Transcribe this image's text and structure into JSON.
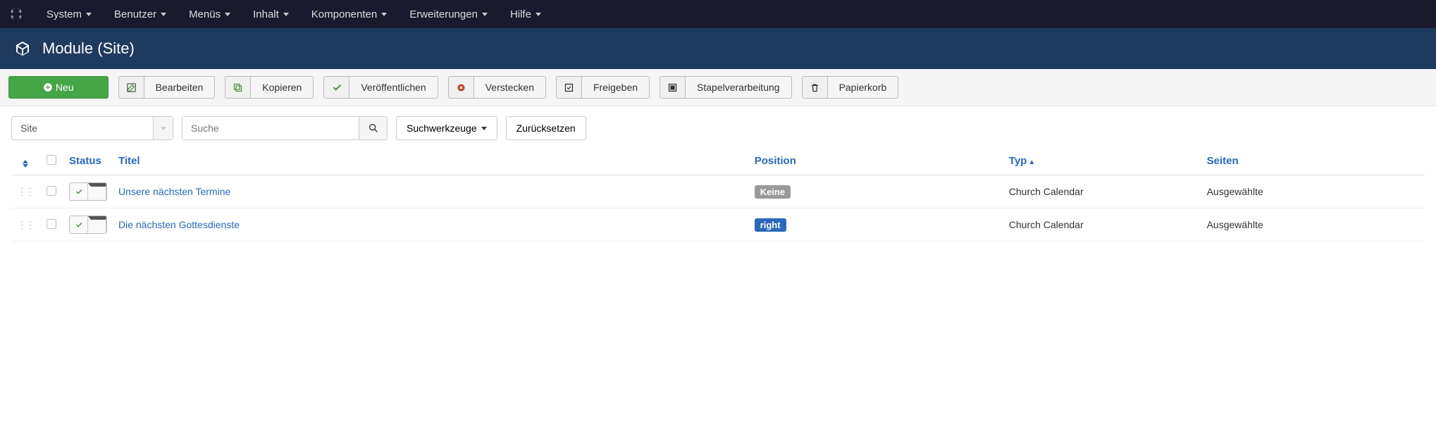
{
  "topnav": {
    "items": [
      "System",
      "Benutzer",
      "Menüs",
      "Inhalt",
      "Komponenten",
      "Erweiterungen",
      "Hilfe"
    ]
  },
  "header": {
    "title": "Module (Site)"
  },
  "toolbar": {
    "new_label": "Neu",
    "edit_label": "Bearbeiten",
    "copy_label": "Kopieren",
    "publish_label": "Veröffentlichen",
    "hide_label": "Verstecken",
    "checkin_label": "Freigeben",
    "batch_label": "Stapelverarbeitung",
    "trash_label": "Papierkorb"
  },
  "filters": {
    "client_selected": "Site",
    "search_placeholder": "Suche",
    "tools_label": "Suchwerkzeuge",
    "clear_label": "Zurücksetzen"
  },
  "columns": {
    "status": "Status",
    "title": "Titel",
    "position": "Position",
    "type": "Typ",
    "pages": "Seiten"
  },
  "rows": [
    {
      "title": "Unsere nächsten Termine",
      "position": "Keine",
      "position_style": "gray",
      "type": "Church Calendar",
      "pages": "Ausgewählte"
    },
    {
      "title": "Die nächsten Gottesdienste",
      "position": "right",
      "position_style": "blue",
      "type": "Church Calendar",
      "pages": "Ausgewählte"
    }
  ]
}
